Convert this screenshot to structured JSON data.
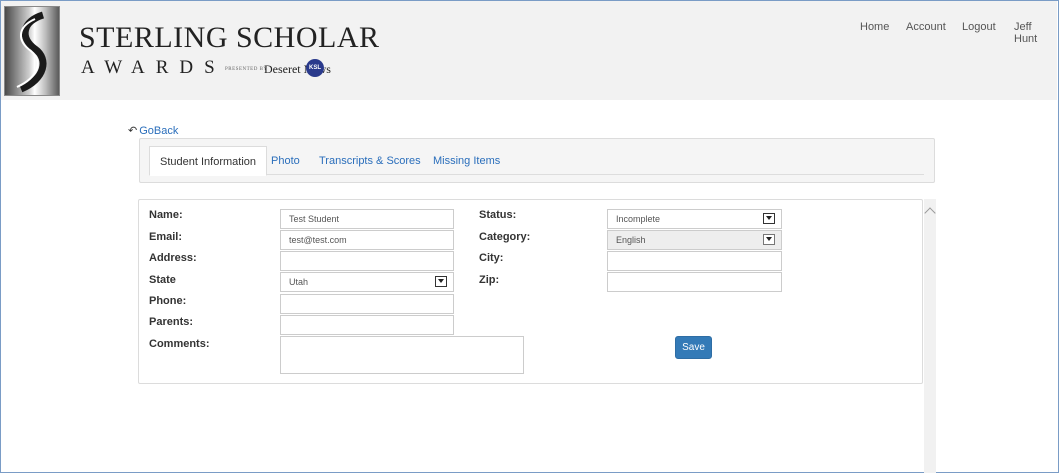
{
  "brand": {
    "title": "STERLING SCHOLAR",
    "subtitle": "AWARDS",
    "presented_by": "PRESENTED BY",
    "sponsor": "Deseret News",
    "sponsor_logo": "KSL"
  },
  "topnav": {
    "home": "Home",
    "account": "Account",
    "logout": "Logout",
    "user": "Jeff Hunt"
  },
  "goback": {
    "label": "GoBack",
    "icon": "back-arrow-icon"
  },
  "tabs": [
    {
      "label": "Student Information",
      "active": true
    },
    {
      "label": "Photo"
    },
    {
      "label": "Transcripts & Scores"
    },
    {
      "label": "Missing Items"
    }
  ],
  "form": {
    "name": {
      "label": "Name:",
      "value": "Test Student"
    },
    "email": {
      "label": "Email:",
      "value": "test@test.com"
    },
    "address": {
      "label": "Address:",
      "value": ""
    },
    "state": {
      "label": "State",
      "value": "Utah"
    },
    "phone": {
      "label": "Phone:",
      "value": ""
    },
    "parents": {
      "label": "Parents:",
      "value": ""
    },
    "comments": {
      "label": "Comments:",
      "value": ""
    },
    "status": {
      "label": "Status:",
      "value": "Incomplete"
    },
    "category": {
      "label": "Category:",
      "value": "English"
    },
    "city": {
      "label": "City:",
      "value": ""
    },
    "zip": {
      "label": "Zip:",
      "value": ""
    },
    "save_label": "Save"
  },
  "colors": {
    "accent": "#337ab7",
    "link": "#2a6ebb",
    "header_bg": "#f2f2f2"
  }
}
